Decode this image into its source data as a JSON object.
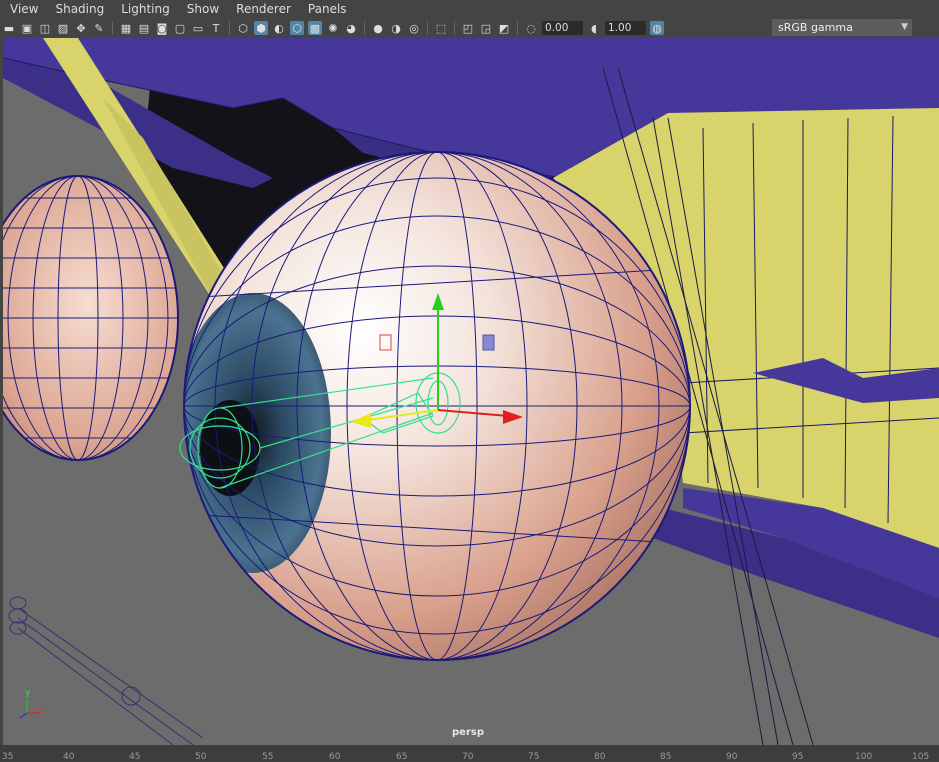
{
  "menubar": {
    "items": [
      "View",
      "Shading",
      "Lighting",
      "Show",
      "Renderer",
      "Panels"
    ]
  },
  "toolbar": {
    "exposure_value": "0.00",
    "gamma_value": "1.00",
    "color_space": "sRGB gamma"
  },
  "viewport": {
    "camera_label": "persp",
    "axis": {
      "x": "x",
      "y": "y"
    }
  },
  "timeline": {
    "ticks": [
      "35",
      "40",
      "45",
      "50",
      "55",
      "60",
      "65",
      "70",
      "75",
      "80",
      "85",
      "90",
      "95",
      "100",
      "105"
    ]
  },
  "colors": {
    "eyeball_skin": "#e2ae9c",
    "iris": "#3a5f7a",
    "geometry_purple": "#46379a",
    "geometry_yellow": "#d8d36b",
    "background_grey": "#6c6c6c",
    "wire_blue": "#1a1a7a"
  }
}
